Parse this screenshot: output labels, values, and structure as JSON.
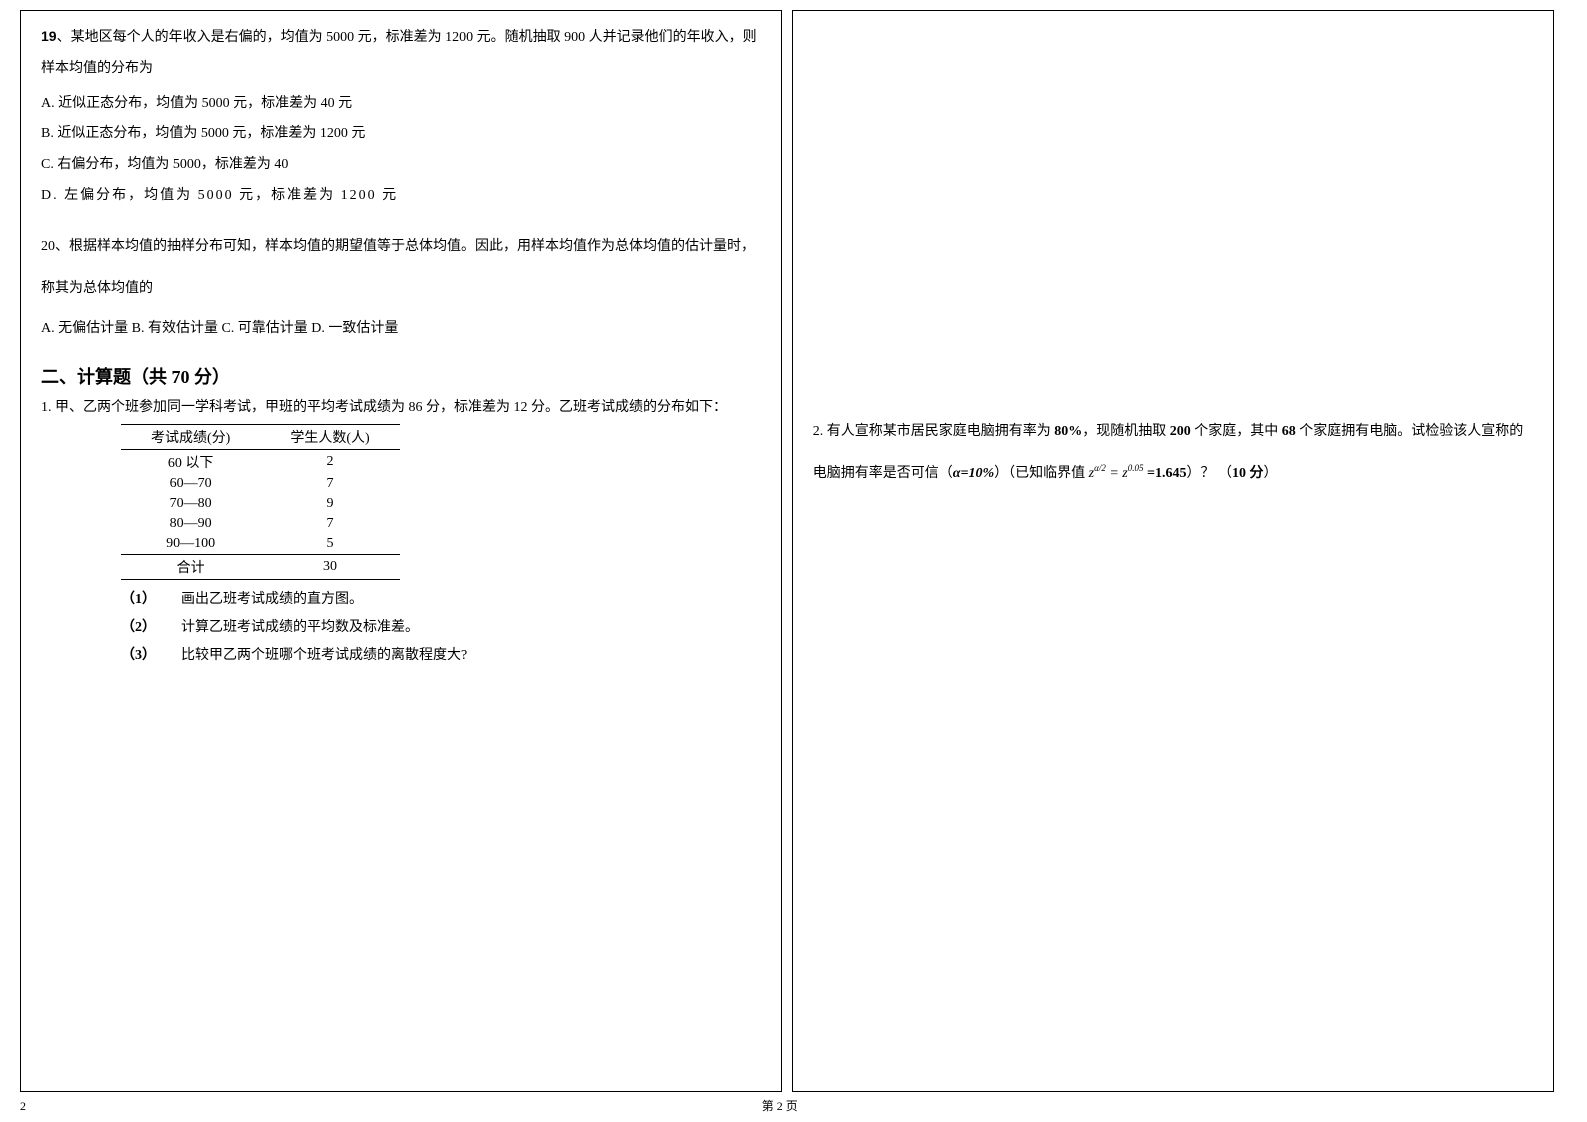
{
  "left": {
    "q19": {
      "num": "19",
      "text": "、某地区每个人的年收入是右偏的，均值为 5000 元，标准差为 1200 元。随机抽取 900 人并记录他们的年收入，则样本均值的分布为",
      "optA": "A. 近似正态分布，均值为 5000 元，标准差为 40 元",
      "optB": "B. 近似正态分布，均值为 5000 元，标准差为 1200 元",
      "optC": "C. 右偏分布，均值为 5000，标准差为 40",
      "optD": "D. 左偏分布，均值为 5000 元，标准差为 1200 元"
    },
    "q20": {
      "num": "20",
      "text": "、根据样本均值的抽样分布可知，样本均值的期望值等于总体均值。因此，用样本均值作为总体均值的估计量时，称其为总体均值的",
      "opts": "A. 无偏估计量      B. 有效估计量    C. 可靠估计量      D. 一致估计量"
    },
    "section2": {
      "title": "二、计算题（共 70 分）",
      "q1": {
        "text": "1. 甲、乙两个班参加同一学科考试，甲班的平均考试成绩为 86 分，标准差为 12 分。乙班考试成绩的分布如下：",
        "table": {
          "headers": [
            "考试成绩(分)",
            "学生人数(人)"
          ],
          "rows": [
            [
              "60 以下",
              "2"
            ],
            [
              "60—70",
              "7"
            ],
            [
              "70—80",
              "9"
            ],
            [
              "80—90",
              "7"
            ],
            [
              "90—100",
              "5"
            ]
          ],
          "total": [
            "合计",
            "30"
          ]
        },
        "sub1_num": "（1）",
        "sub1": "画出乙班考试成绩的直方图。",
        "sub2_num": "（2）",
        "sub2": "计算乙班考试成绩的平均数及标准差。",
        "sub3_num": "（3）",
        "sub3": "比较甲乙两个班哪个班考试成绩的离散程度大?"
      }
    }
  },
  "right": {
    "q2": {
      "part1": "2. 有人宣称某市居民家庭电脑拥有率为 ",
      "pct": "80%",
      "part2": "，现随机抽取 ",
      "n": "200",
      "part3": " 个家庭，其中 ",
      "k": "68",
      "part4": " 个家庭拥有电脑。试检验该人宣称的电脑拥有率是否可信（",
      "alpha_label": "α=10%",
      "part5": "）（已知临界值 ",
      "formula_lhs": "z",
      "formula_sub1": "α/2",
      "formula_eq": " = ",
      "formula_rhs": "z",
      "formula_sub2": "0.05",
      "crit": " =1.645",
      "part6": "）？ （",
      "pts": "10 分",
      "part7": "）"
    }
  },
  "footer": {
    "pageLeftNum": "2",
    "pageLabel": "第    2    页"
  }
}
